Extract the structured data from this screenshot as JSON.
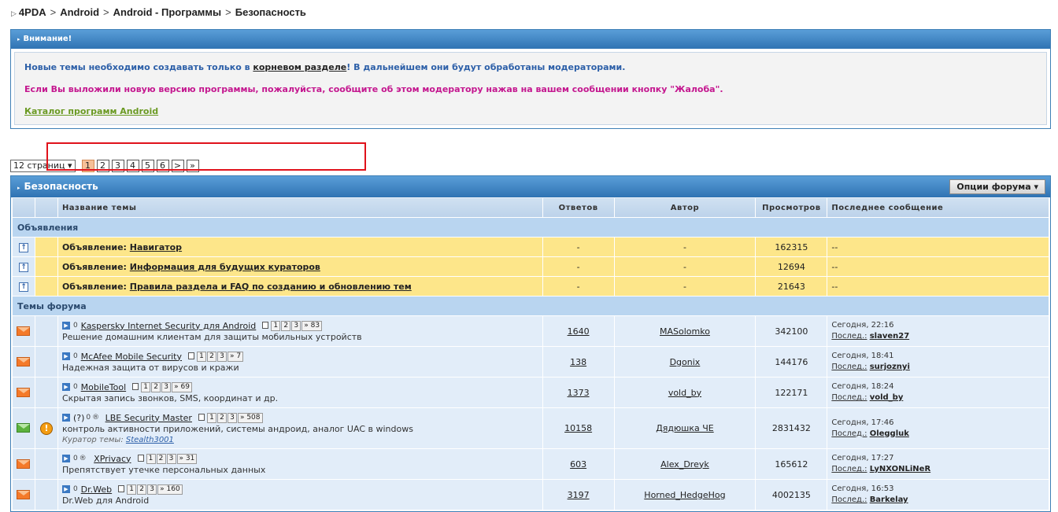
{
  "breadcrumb": [
    "4PDA",
    "Android",
    "Android - Программы",
    "Безопасность"
  ],
  "notice": {
    "title": "Внимание!",
    "line1_pre": "Новые темы необходимо создавать только в ",
    "line1_link": "корневом разделе",
    "line1_post": "! В дальнейшем они будут обработаны модераторами.",
    "line2": "Если Вы выложили новую версию программы, пожалуйста, сообщите об этом модератору нажав на вашем сообщении кнопку \"Жалоба\".",
    "line3_link": "Каталог программ Android"
  },
  "pager": {
    "pages_label": "12 страниц ▾",
    "pages": [
      "1",
      "2",
      "3",
      "4",
      "5",
      "6"
    ],
    "current": "1",
    "next": ">",
    "last": "»"
  },
  "forum": {
    "title": "Безопасность",
    "options_label": "Опции форума ▾",
    "columns": {
      "topic": "Название темы",
      "replies": "Ответов",
      "author": "Автор",
      "views": "Просмотров",
      "last": "Последнее сообщение"
    },
    "section_announcements": "Объявления",
    "section_topics": "Темы форума",
    "announcements": [
      {
        "prefix": "Объявление: ",
        "title": "Навигатор",
        "replies": "-",
        "author": "-",
        "views": "162315",
        "last": "--"
      },
      {
        "prefix": "Объявление: ",
        "title": "Информация для будущих кураторов",
        "replies": "-",
        "author": "-",
        "views": "12694",
        "last": "--"
      },
      {
        "prefix": "Объявление: ",
        "title": "Правила раздела и FAQ по созданию и обновлению тем",
        "replies": "-",
        "author": "-",
        "views": "21643",
        "last": "--"
      }
    ],
    "topics": [
      {
        "prefix": "",
        "title": "Kaspersky Internet Security для Android",
        "pages": [
          "1",
          "2",
          "3",
          "» 83"
        ],
        "desc": "Решение домашним клиентам для защиты мобильных устройств",
        "replies": "1640",
        "author": "MASolomko",
        "views": "342100",
        "last_time": "Сегодня, 22:16",
        "last_label": "Послед.:",
        "last_user": "slaven27"
      },
      {
        "prefix": "",
        "title": "McAfee Mobile Security",
        "pages": [
          "1",
          "2",
          "3",
          "» 7"
        ],
        "desc": "Надежная защита от вирусов и кражи",
        "replies": "138",
        "author": "Dgonix",
        "views": "144176",
        "last_time": "Сегодня, 18:41",
        "last_label": "Послед.:",
        "last_user": "surjoznyi"
      },
      {
        "prefix": "",
        "title": "MobileTool",
        "pages": [
          "1",
          "2",
          "3",
          "» 69"
        ],
        "desc": "Скрытая запись звонков, SMS, координат и др.",
        "replies": "1373",
        "author": "vold_by",
        "views": "122171",
        "last_time": "Сегодня, 18:24",
        "last_label": "Послед.:",
        "last_user": "vold_by"
      },
      {
        "prefix": "(?) ",
        "title": "LBE Security Master",
        "pages": [
          "1",
          "2",
          "3",
          "» 508"
        ],
        "desc": "контроль активности приложений, системы андроид, аналог UAC в windows",
        "curator_label": "Куратор темы: ",
        "curator": "Stealth3001",
        "replies": "10158",
        "author": "Дядюшка ЧЕ",
        "views": "2831432",
        "last_time": "Сегодня, 17:46",
        "last_label": "Послед.:",
        "last_user": "Oleggluk"
      },
      {
        "prefix": "",
        "title": "XPrivacy",
        "pages": [
          "1",
          "2",
          "3",
          "» 31"
        ],
        "desc": "Препятствует утечке персональных данных",
        "replies": "603",
        "author": "Alex_Dreyk",
        "views": "165612",
        "last_time": "Сегодня, 17:27",
        "last_label": "Послед.:",
        "last_user": "LyNXONLiNeR"
      },
      {
        "prefix": "",
        "title": "Dr.Web",
        "pages": [
          "1",
          "2",
          "3",
          "» 160"
        ],
        "desc": "Dr.Web для Android",
        "replies": "3197",
        "author": "Horned_HedgeHog",
        "views": "4002135",
        "last_time": "Сегодня, 16:53",
        "last_label": "Послед.:",
        "last_user": "Barkelay"
      }
    ]
  }
}
